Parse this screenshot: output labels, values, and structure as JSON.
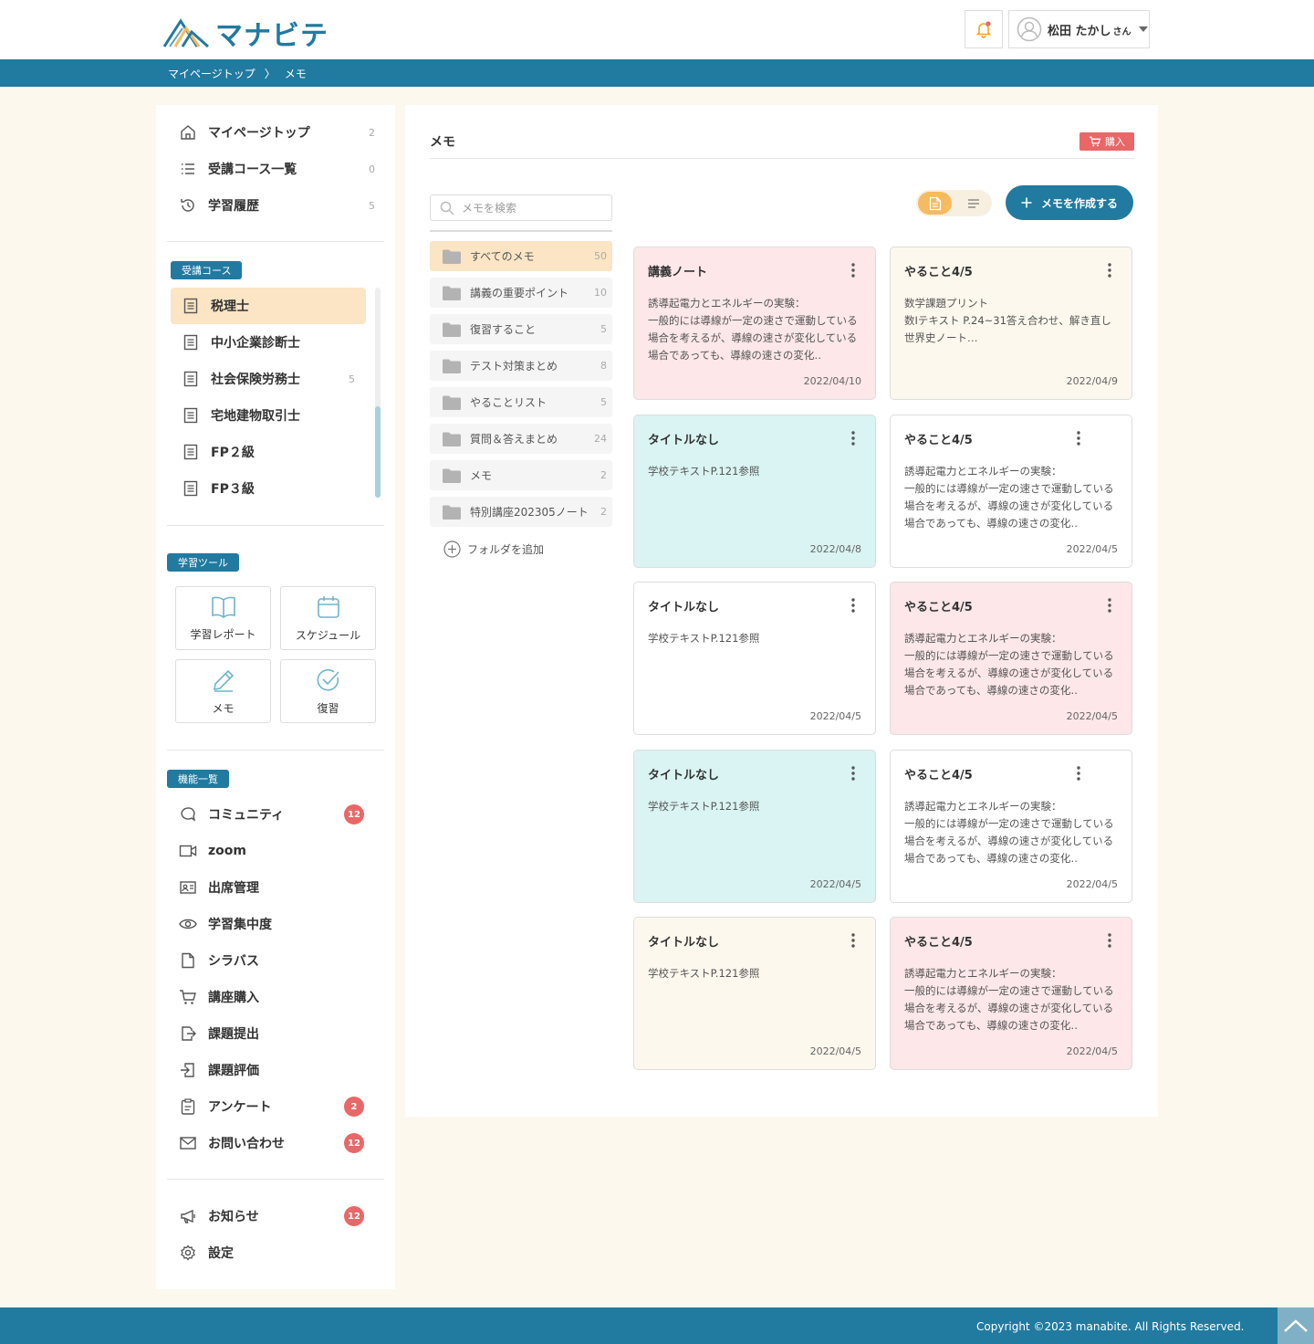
{
  "header": {
    "logo_text": "マナビテ",
    "user_name": "松田 たかし",
    "user_suffix": "さん"
  },
  "breadcrumb": {
    "home": "マイページトップ",
    "separator": "〉",
    "current": "メモ"
  },
  "sidebar": {
    "top_items": [
      {
        "label": "マイページトップ",
        "count": "2"
      },
      {
        "label": "受講コース一覧",
        "count": "0"
      },
      {
        "label": "学習履歴",
        "count": "5"
      }
    ],
    "courses_tag": "受講コース",
    "courses": [
      {
        "label": "税理士",
        "count": ""
      },
      {
        "label": "中小企業診断士",
        "count": ""
      },
      {
        "label": "社会保険労務士",
        "count": "5"
      },
      {
        "label": "宅地建物取引士",
        "count": ""
      },
      {
        "label": "FP２級",
        "count": ""
      },
      {
        "label": "FP３級",
        "count": ""
      }
    ],
    "tools_tag": "学習ツール",
    "tools": [
      {
        "label": "学習レポート"
      },
      {
        "label": "スケジュール"
      },
      {
        "label": "メモ"
      },
      {
        "label": "復習"
      }
    ],
    "features_tag": "機能一覧",
    "features": [
      {
        "label": "コミュニティ",
        "badge": "12"
      },
      {
        "label": "zoom",
        "badge": ""
      },
      {
        "label": "出席管理",
        "badge": ""
      },
      {
        "label": "学習集中度",
        "badge": ""
      },
      {
        "label": "シラバス",
        "badge": ""
      },
      {
        "label": "講座購入",
        "badge": ""
      },
      {
        "label": "課題提出",
        "badge": ""
      },
      {
        "label": "課題評価",
        "badge": ""
      },
      {
        "label": "アンケート",
        "badge": "2"
      },
      {
        "label": "お問い合わせ",
        "badge": "12"
      }
    ],
    "bottom": [
      {
        "label": "お知らせ",
        "badge": "12"
      },
      {
        "label": "設定",
        "badge": ""
      }
    ]
  },
  "main": {
    "title": "メモ",
    "buy_label": "購入",
    "search_placeholder": "メモを検索",
    "create_label": "メモを作成する",
    "add_folder_label": "フォルダを追加",
    "folders": [
      {
        "label": "すべてのメモ",
        "count": "50"
      },
      {
        "label": "講義の重要ポイント",
        "count": "10"
      },
      {
        "label": "復習すること",
        "count": "5"
      },
      {
        "label": "テスト対策まとめ",
        "count": "8"
      },
      {
        "label": "やることリスト",
        "count": "5"
      },
      {
        "label": "質問＆答えまとめ",
        "count": "24"
      },
      {
        "label": "メモ",
        "count": "2"
      },
      {
        "label": "特別講座202305ノート",
        "count": "2"
      }
    ],
    "cards": [
      {
        "title": "講義ノート",
        "body": "誘導起電力とエネルギーの実験：\n一般的には導線が一定の速さで運動している場合を考えるが、導線の速さが変化している場合であっても、導線の速さの変化‥",
        "date": "2022/04/10",
        "color": "pink"
      },
      {
        "title": "やること4/5",
        "body": "数学課題プリント\n数Ⅰテキスト P.24~31答え合わせ、解き直し\n世界史ノート…",
        "date": "2022/04/9",
        "color": "cream"
      },
      {
        "title": "タイトルなし",
        "body": "学校テキストP.121参照",
        "date": "2022/04/8",
        "color": "mint"
      },
      {
        "title": "やること4/5",
        "body": "誘導起電力とエネルギーの実験：\n一般的には導線が一定の速さで運動している場合を考えるが、導線の速さが変化している場合であっても、導線の速さの変化‥",
        "date": "2022/04/5",
        "color": "white"
      },
      {
        "title": "タイトルなし",
        "body": "学校テキストP.121参照",
        "date": "2022/04/5",
        "color": "white"
      },
      {
        "title": "やること4/5",
        "body": "誘導起電力とエネルギーの実験：\n一般的には導線が一定の速さで運動している場合を考えるが、導線の速さが変化している場合であっても、導線の速さの変化‥",
        "date": "2022/04/5",
        "color": "pink"
      },
      {
        "title": "タイトルなし",
        "body": "学校テキストP.121参照",
        "date": "2022/04/5",
        "color": "mint"
      },
      {
        "title": "やること4/5",
        "body": "誘導起電力とエネルギーの実験：\n一般的には導線が一定の速さで運動している場合を考えるが、導線の速さが変化している場合であっても、導線の速さの変化‥",
        "date": "2022/04/5",
        "color": "white"
      },
      {
        "title": "タイトルなし",
        "body": "学校テキストP.121参照",
        "date": "2022/04/5",
        "color": "cream"
      },
      {
        "title": "やること4/5",
        "body": "誘導起電力とエネルギーの実験：\n一般的には導線が一定の速さで運動している場合を考えるが、導線の速さが変化している場合であっても、導線の速さの変化‥",
        "date": "2022/04/5",
        "color": "pink"
      }
    ]
  },
  "footer": {
    "copyright": "Copyright ©2023 manabite. All Rights Reserved."
  },
  "colors": {
    "brand": "#217aa0",
    "accent": "#f6bb60",
    "alert": "#e96767",
    "page_bg": "#fdf8ee"
  },
  "icons": [
    "logo-mountain-icon",
    "bell-icon",
    "avatar-icon",
    "home-icon",
    "list-icon",
    "history-icon",
    "document-icon",
    "book-icon",
    "calendar-icon",
    "pencil-icon",
    "check-circle-icon",
    "chat-icon",
    "video-icon",
    "id-card-icon",
    "eye-icon",
    "file-icon",
    "cart-icon",
    "export-icon",
    "import-icon",
    "clipboard-icon",
    "mail-icon",
    "megaphone-icon",
    "gear-icon",
    "search-icon",
    "folder-icon",
    "plus-circle-icon",
    "plus-icon",
    "grid-view-icon",
    "list-view-icon",
    "kebab-menu-icon",
    "chevron-up-icon"
  ]
}
